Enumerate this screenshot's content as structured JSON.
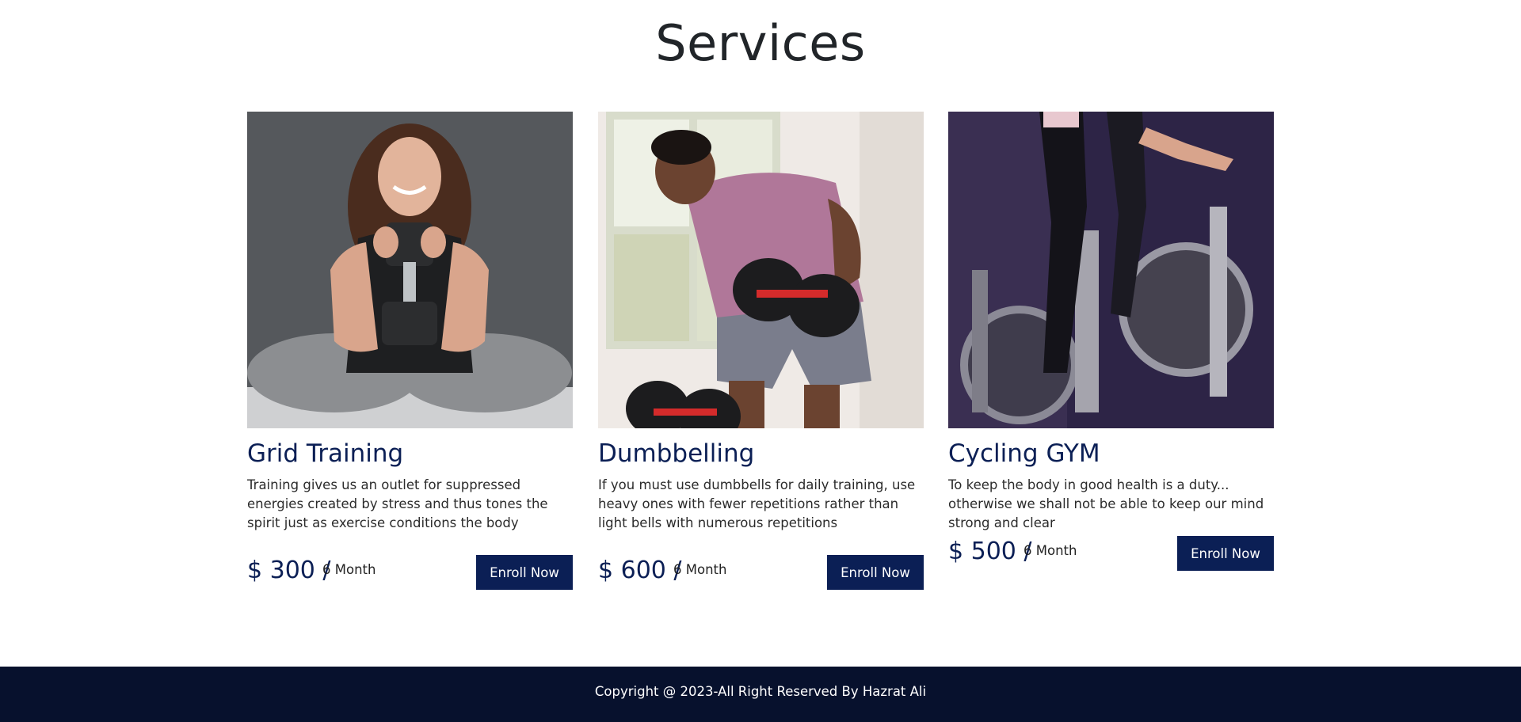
{
  "page": {
    "title": "Services"
  },
  "services": [
    {
      "title": "Grid Training",
      "description": "Training gives us an outlet for suppressed energies created by stress and thus tones the spirit just as exercise conditions the body",
      "price": "$ 300 /",
      "period": "6 Month",
      "button_label": "Enroll Now"
    },
    {
      "title": "Dumbbelling",
      "description": "If you must use dumbbells for daily training, use heavy ones with fewer repetitions rather than light bells with numerous repetitions",
      "price": "$ 600 /",
      "period": "6 Month",
      "button_label": "Enroll Now"
    },
    {
      "title": "Cycling GYM",
      "description": "To keep the body in good health is a duty... otherwise we shall not be able to keep our mind strong and clear",
      "price": "$ 500 /",
      "period": "6 Month",
      "button_label": "Enroll Now"
    }
  ],
  "footer": {
    "copyright": "Copyright @ 2023-All Right Reserved By Hazrat Ali"
  },
  "colors": {
    "brand_navy": "#0b1f55",
    "footer_bg": "#07112d",
    "title_text": "#212529"
  }
}
